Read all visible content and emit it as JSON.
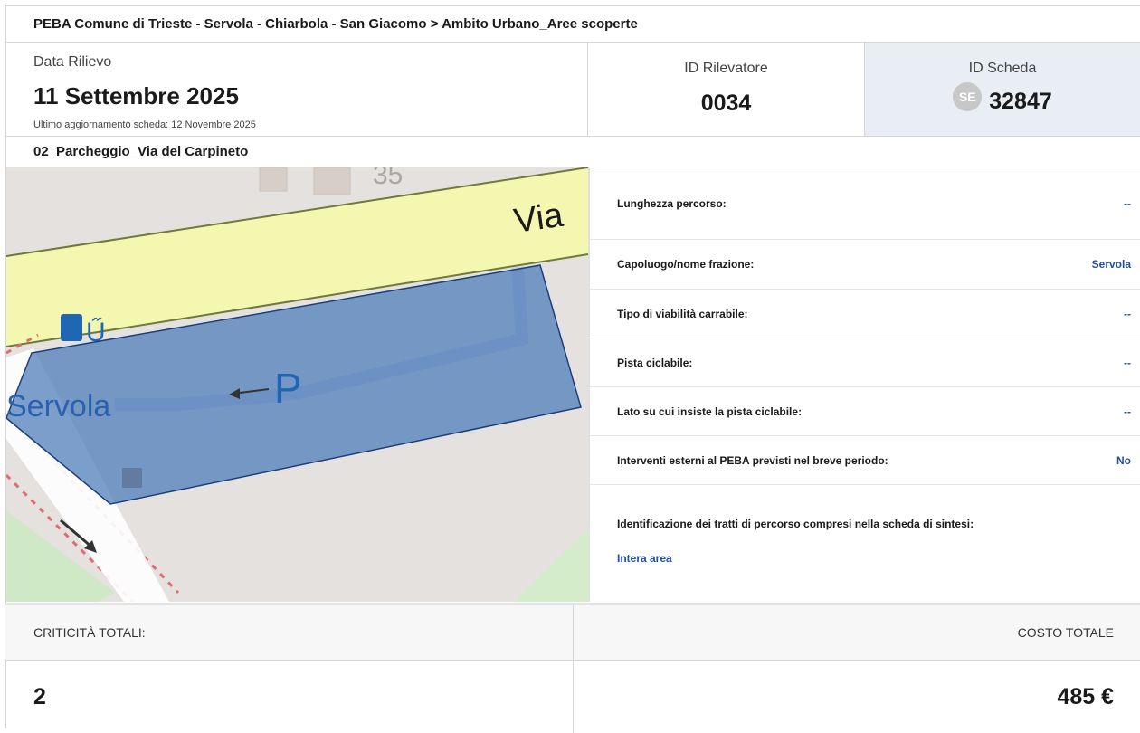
{
  "breadcrumb": "PEBA Comune di Trieste - Servola - Chiarbola - San Giacomo > Ambito Urbano_Aree scoperte",
  "header": {
    "date_label": "Data Rilievo",
    "date_value": "11 Settembre 2025",
    "last_update": "Ultimo aggiornamento scheda: 12 Novembre 2025",
    "rilevatore_label": "ID Rilevatore",
    "rilevatore_value": "0034",
    "scheda_label": "ID Scheda",
    "scheda_badge": "SE",
    "scheda_value": "32847"
  },
  "subtitle": "02_Parcheggio_Via del Carpineto",
  "map": {
    "labels": {
      "road": "Via",
      "area": "Servola",
      "parking": "P",
      "house_number": "35"
    },
    "colors": {
      "road": "#f3f7b0",
      "area_fill": "#4a7ab8",
      "parking_text": "#1f66b5"
    }
  },
  "properties": [
    {
      "label": "Lunghezza percorso:",
      "value": "--"
    },
    {
      "label": "Capoluogo/nome frazione:",
      "value": "Servola"
    },
    {
      "label": "Tipo di viabilità carrabile:",
      "value": "--"
    },
    {
      "label": "Pista ciclabile:",
      "value": "--"
    },
    {
      "label": "Lato su cui insiste la pista ciclabile:",
      "value": "--"
    },
    {
      "label": "Interventi esterni al PEBA previsti nel breve periodo:",
      "value": "No"
    }
  ],
  "tratti": {
    "label": "Identificazione dei tratti di percorso compresi nella scheda di sintesi:",
    "value": "Intera area"
  },
  "footer": {
    "criticita_label": "CRITICITÀ TOTALI:",
    "costo_label": "COSTO TOTALE",
    "criticita_value": "2",
    "costo_value": "485 €"
  }
}
